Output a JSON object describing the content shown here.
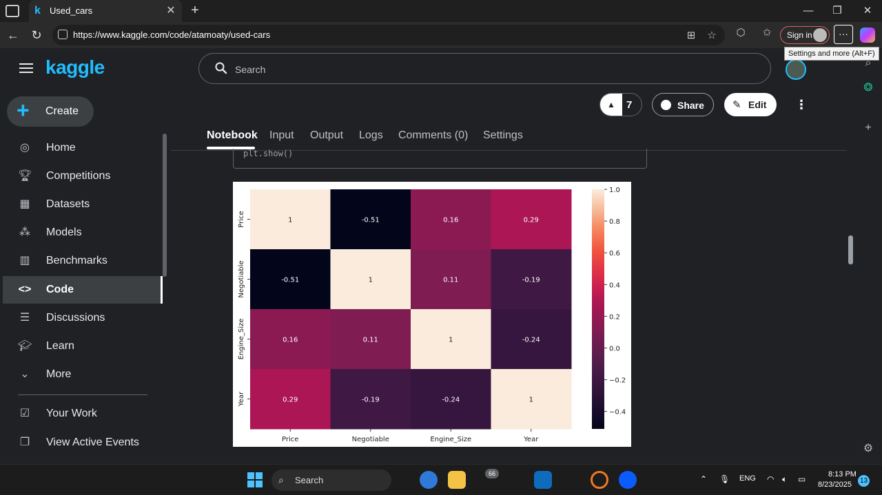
{
  "browser": {
    "tab_title": "Used_cars",
    "url": "https://www.kaggle.com/code/atamoaty/used-cars",
    "signin_label": "Sign in",
    "tooltip": "Settings and more (Alt+F)"
  },
  "kaggle": {
    "logo": "kaggle",
    "create_label": "Create",
    "nav": [
      {
        "label": "Home",
        "icon": "compass-icon"
      },
      {
        "label": "Competitions",
        "icon": "trophy-icon"
      },
      {
        "label": "Datasets",
        "icon": "table-icon"
      },
      {
        "label": "Models",
        "icon": "models-icon"
      },
      {
        "label": "Benchmarks",
        "icon": "bar-chart-icon"
      },
      {
        "label": "Code",
        "icon": "code-icon"
      },
      {
        "label": "Discussions",
        "icon": "discussion-icon"
      },
      {
        "label": "Learn",
        "icon": "school-icon"
      },
      {
        "label": "More",
        "icon": "chevron-down-icon"
      },
      {
        "label": "Your Work",
        "icon": "your-work-icon"
      },
      {
        "label": "View Active Events",
        "icon": "events-icon"
      }
    ],
    "search_placeholder": "Search",
    "vote_count": "7",
    "share_label": "Share",
    "edit_label": "Edit",
    "tabs": [
      "Notebook",
      "Input",
      "Output",
      "Logs",
      "Comments (0)",
      "Settings"
    ],
    "code_snippet": "plt.show()"
  },
  "chart_data": {
    "type": "heatmap",
    "rows": [
      "Price",
      "Negotiable",
      "Engine_Size",
      "Year"
    ],
    "columns": [
      "Price",
      "Negotiable",
      "Engine_Size",
      "Year"
    ],
    "values": [
      [
        1,
        -0.51,
        0.16,
        0.29
      ],
      [
        -0.51,
        1,
        0.11,
        -0.19
      ],
      [
        0.16,
        0.11,
        1,
        -0.24
      ],
      [
        0.29,
        -0.19,
        -0.24,
        1
      ]
    ],
    "cell_labels": [
      [
        "1",
        "-0.51",
        "0.16",
        "0.29"
      ],
      [
        "-0.51",
        "1",
        "0.11",
        "-0.19"
      ],
      [
        "0.16",
        "0.11",
        "1",
        "-0.24"
      ],
      [
        "0.29",
        "-0.19",
        "-0.24",
        "1"
      ]
    ],
    "colorbar_ticks": [
      1.0,
      0.8,
      0.6,
      0.4,
      0.2,
      0.0,
      -0.2,
      -0.4
    ],
    "colorbar_tick_labels": [
      "1.0",
      "0.8",
      "0.6",
      "0.4",
      "0.2",
      "0.0",
      "−0.2",
      "−0.4"
    ],
    "vmin": -0.51,
    "vmax": 1.0,
    "colormap": "rocket"
  },
  "taskbar": {
    "search_label": "Search",
    "badge": "66",
    "lang": "ENG",
    "time": "8:13 PM",
    "date": "8/23/2025",
    "notifications": "13"
  }
}
